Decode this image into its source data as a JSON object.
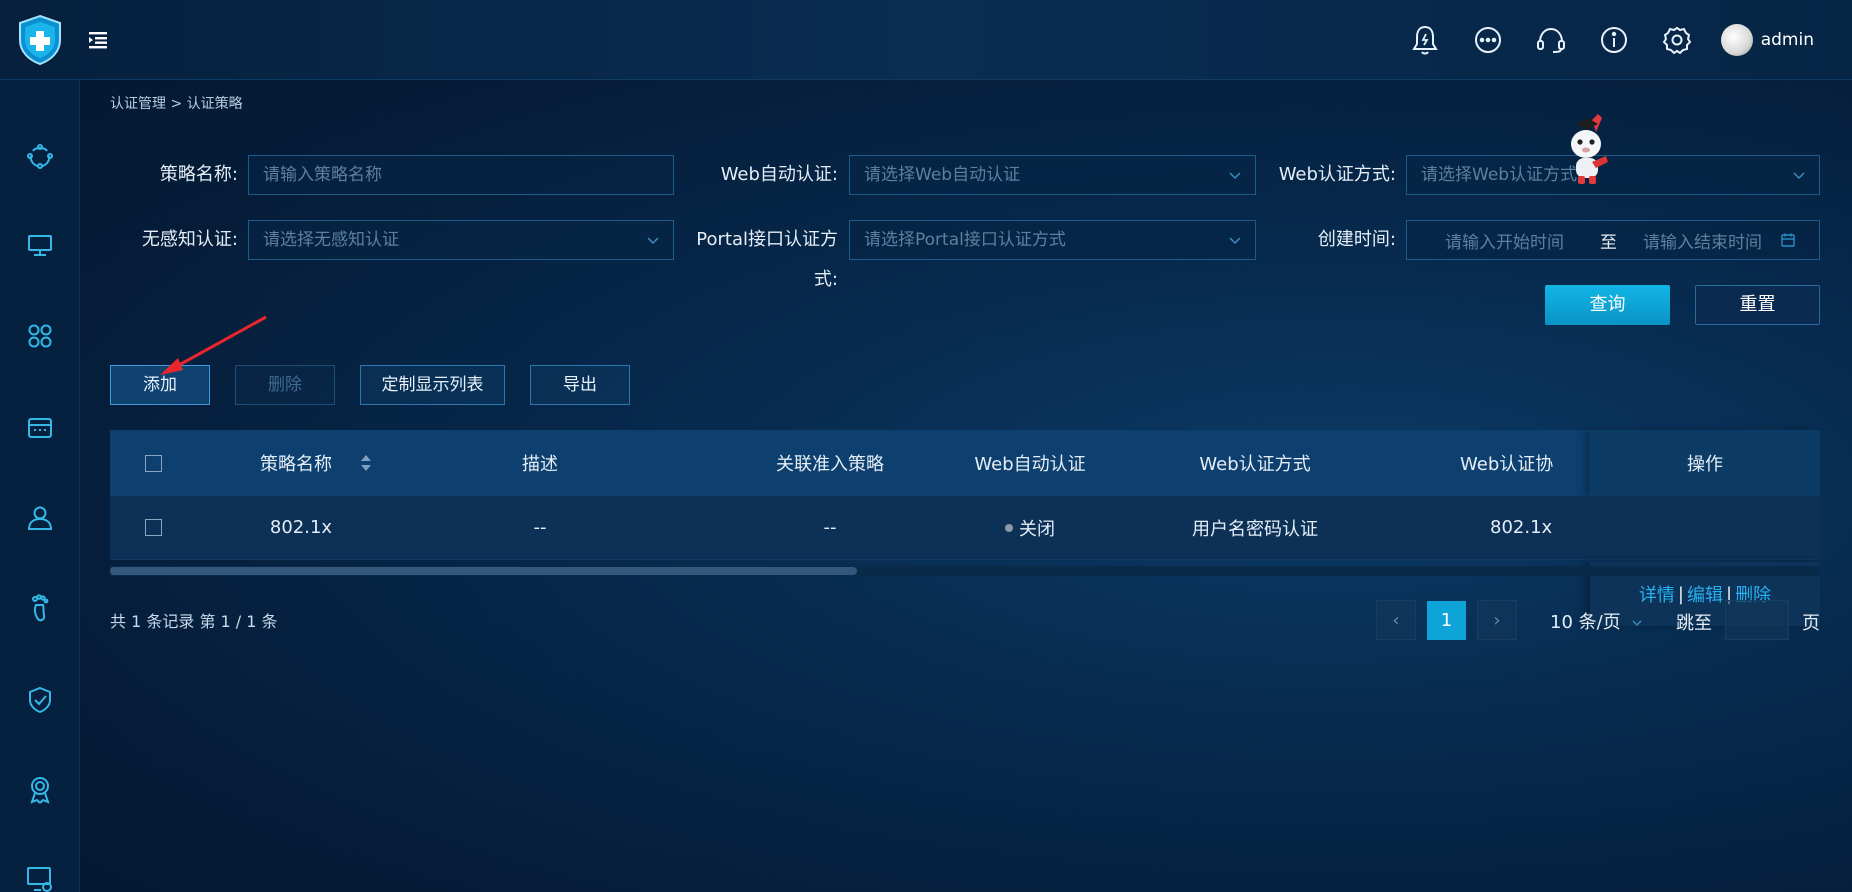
{
  "header": {
    "username": "admin",
    "icons": [
      "logo-shield-icon",
      "menu-toggle-icon",
      "bell-icon",
      "more-icon",
      "headset-icon",
      "info-icon",
      "gear-icon",
      "avatar"
    ]
  },
  "sidebar": {
    "icons": [
      "topology-icon",
      "monitor-icon",
      "apps-icon",
      "device-icon",
      "user-icon",
      "footprint-icon",
      "shield-check-icon",
      "badge-icon",
      "screen-settings-icon"
    ]
  },
  "breadcrumb": {
    "parent": "认证管理",
    "separator": ">",
    "current": "认证策略"
  },
  "filters": {
    "policy_name_label": "策略名称:",
    "policy_name_placeholder": "请输入策略名称",
    "web_auto_label": "Web自动认证:",
    "web_auto_placeholder": "请选择Web自动认证",
    "web_method_label": "Web认证方式:",
    "web_method_placeholder": "请选择Web认证方式",
    "senseless_label": "无感知认证:",
    "senseless_placeholder": "请选择无感知认证",
    "portal_label": "Portal接口认证方式:",
    "portal_placeholder": "请选择Portal接口认证方式",
    "created_label": "创建时间:",
    "start_placeholder": "请输入开始时间",
    "range_separator": "至",
    "end_placeholder": "请输入结束时间"
  },
  "buttons": {
    "query": "查询",
    "reset": "重置",
    "add": "添加",
    "delete": "删除",
    "custom_columns": "定制显示列表",
    "export": "导出"
  },
  "table": {
    "columns": [
      "策略名称",
      "描述",
      "关联准入策略",
      "Web自动认证",
      "Web认证方式",
      "Web认证协",
      "操作"
    ],
    "rows": [
      {
        "name": "802.1x",
        "description": "--",
        "linked_policy": "--",
        "web_auto": "关闭",
        "web_method": "用户名密码认证",
        "web_protocol": "802.1x",
        "actions": [
          "详情",
          "编辑",
          "删除"
        ],
        "action_separator": "|"
      }
    ]
  },
  "pagination": {
    "summary": "共 1 条记录 第 1 / 1 条",
    "current_page": "1",
    "prev": "‹",
    "next": "›",
    "page_size": "10 条/页",
    "jump_label": "跳至",
    "page_suffix": "页"
  },
  "colors": {
    "accent": "#0ea4d8",
    "link": "#27b1f0",
    "annotation_arrow": "#e8262b"
  }
}
